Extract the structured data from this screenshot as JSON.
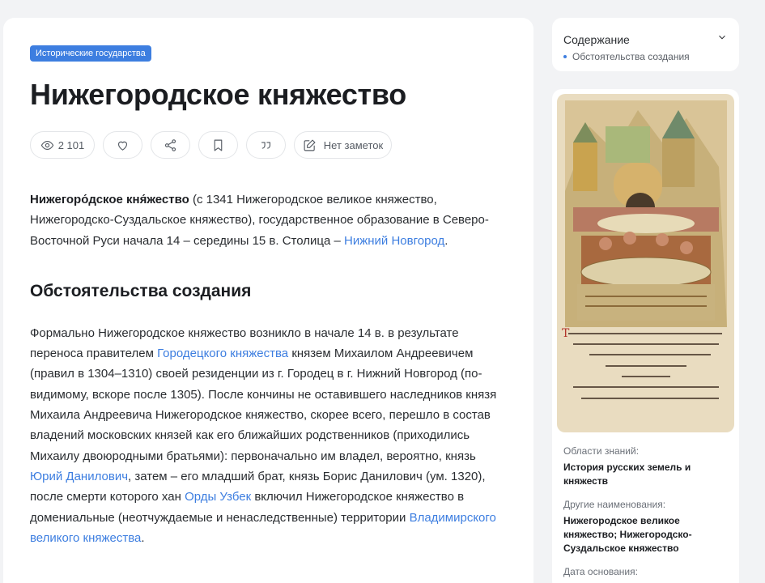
{
  "article": {
    "category": "Исторические государства",
    "title": "Нижегородское княжество",
    "actions": {
      "views": "2 101",
      "notes": "Нет заметок"
    },
    "lead": {
      "term": "Нижегоро́дское кня́жество",
      "text_1": " (с 1341 Нижегородское великое княжество, Нижегородско-Суздальское княжество), государственное образование в Северо-Восточной Руси начала 14 – середины 15 в. Столица – ",
      "link_capital": "Нижний Новгород",
      "text_2": "."
    },
    "section": {
      "title": "Обстоятельства создания",
      "p1": "Формально Нижегородское княжество возникло в начале 14 в. в результате переноса правителем ",
      "link1": "Городецкого княжества",
      "p2": " князем Михаилом Андреевичем (правил в 1304–1310) своей резиденции из г. Городец в г. Нижний Новгород (по-видимому, вскоре после 1305). После кончины не оставившего наследников князя Михаила Андреевича Нижегородское княжество, скорее всего, перешло в состав владений московских князей как его ближайших родственников (приходились Михаилу двоюродными братьями): первоначально им владел, вероятно, князь ",
      "link2": "Юрий Данилович",
      "p3": ", затем – его младший брат, князь Борис Данилович (ум. 1320), после смерти которого хан ",
      "link3": "Орды Узбек",
      "p4": " включил Нижегородское княжество в домениальные (неотчуждаемые и ненаследственные) территории ",
      "link4": "Владимирского великого княжества",
      "p5": "."
    }
  },
  "toc": {
    "title": "Содержание",
    "items": [
      "Обстоятельства создания"
    ]
  },
  "infobox": {
    "fields": [
      {
        "label": "Области знаний:",
        "value": "История русских земель и княжеств"
      },
      {
        "label": "Другие наименования:",
        "value": "Нижегородское великое княжество; Нижегородско-Суздальское княжество"
      },
      {
        "label": "Дата основания:",
        "value": ""
      }
    ]
  },
  "colors": {
    "accent": "#3d7ee0",
    "page_bg": "#f2f3f5"
  },
  "icons": [
    "eye-icon",
    "heart-icon",
    "share-icon",
    "bookmark-icon",
    "quote-icon",
    "note-icon",
    "chevron-down-icon"
  ]
}
